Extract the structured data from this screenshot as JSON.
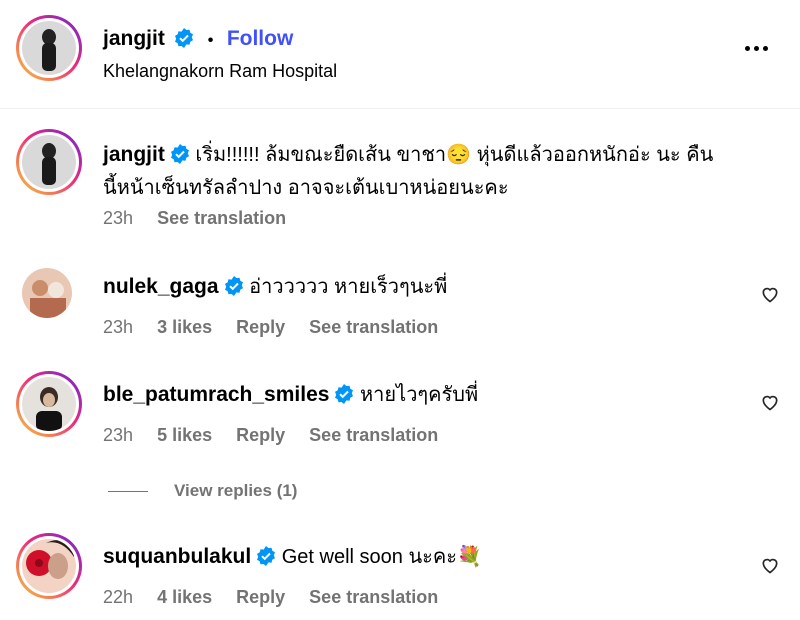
{
  "post_header": {
    "username": "jangjit",
    "separator": "•",
    "follow_label": "Follow",
    "location": "Khelangnakorn Ram Hospital"
  },
  "icons": {
    "verified": "verified-badge-icon",
    "more": "more-options-icon",
    "like": "heart-icon",
    "verified_color": "#0095f6"
  },
  "caption": {
    "username": "jangjit",
    "line1": "เริ่ม!!!!!! ล้มขณะยืดเส้น ขาชา😔 หุ่นดีแล้วออกหนักอ่ะ นะ คืน",
    "line2": "นี้หน้าเซ็นทรัลลำปาง อาจจะเต้นเบาหน่อยนะคะ",
    "time": "23h",
    "see_translation": "See translation"
  },
  "comments": [
    {
      "username": "nulek_gaga",
      "text": "อ่าววววว หายเร็วๆนะพี่",
      "time": "23h",
      "likes": "3 likes",
      "reply": "Reply",
      "see_translation": "See translation"
    },
    {
      "username": "ble_patumrach_smiles",
      "text": "หายไวๆครับพี่",
      "time": "23h",
      "likes": "5 likes",
      "reply": "Reply",
      "see_translation": "See translation"
    },
    {
      "username": "suquanbulakul",
      "text": "Get well soon นะคะ💐",
      "time": "22h",
      "likes": "4 likes",
      "reply": "Reply",
      "see_translation": "See translation"
    }
  ],
  "view_replies": "View replies (1)"
}
